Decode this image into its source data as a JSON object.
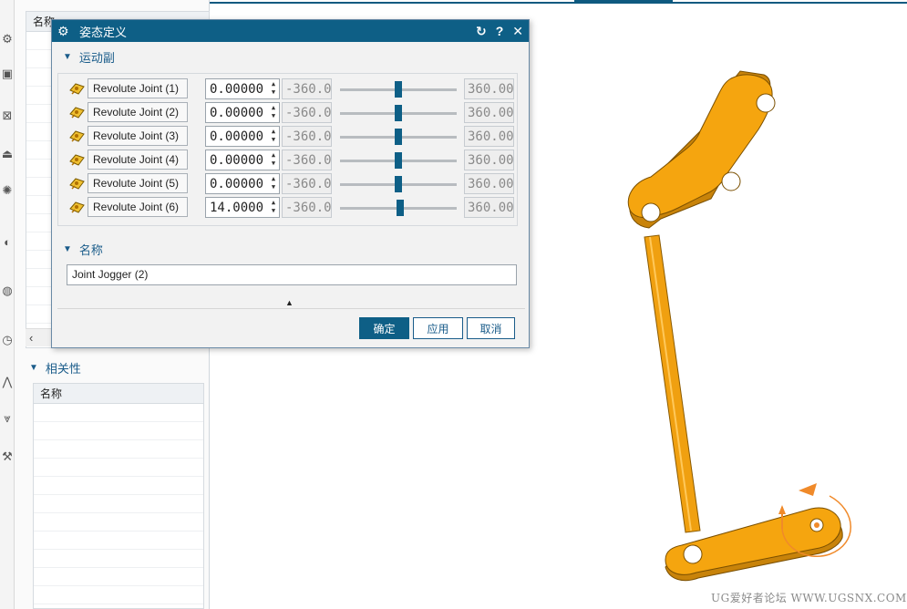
{
  "dialog": {
    "title": "姿态定义",
    "motion_section": "运动副",
    "name_section": "名称",
    "name_value": "Joint Jogger (2)",
    "joints": [
      {
        "label": "Revolute Joint (1)",
        "value": "0.00000",
        "min": "-360.0",
        "max": "360.00",
        "slider_fraction": 0.5
      },
      {
        "label": "Revolute Joint (2)",
        "value": "0.00000",
        "min": "-360.0",
        "max": "360.00",
        "slider_fraction": 0.5
      },
      {
        "label": "Revolute Joint (3)",
        "value": "0.00000",
        "min": "-360.0",
        "max": "360.00",
        "slider_fraction": 0.5
      },
      {
        "label": "Revolute Joint (4)",
        "value": "0.00000",
        "min": "-360.0",
        "max": "360.00",
        "slider_fraction": 0.5
      },
      {
        "label": "Revolute Joint (5)",
        "value": "0.00000",
        "min": "-360.0",
        "max": "360.00",
        "slider_fraction": 0.5
      },
      {
        "label": "Revolute Joint (6)",
        "value": "14.0000",
        "min": "-360.0",
        "max": "360.00",
        "slider_fraction": 0.519
      }
    ],
    "ok_label": "确定",
    "apply_label": "应用",
    "cancel_label": "取消"
  },
  "navigator": {
    "upper_header": "名称",
    "dependency_section": "相关性",
    "dependency_header": "名称"
  },
  "watermark": "UG爱好者论坛 WWW.UGSNX.COM",
  "colors": {
    "title_bar": "#0e5f86",
    "accent": "#1a5c8a",
    "part_fill": "#f5a50f",
    "part_edge": "#7a4f00",
    "rotation_handle": "#f08a2a"
  },
  "icons": {
    "dialog": "gear-icon",
    "reset": "reset-icon",
    "help": "help-icon",
    "close": "close-icon",
    "joint": "revolute-joint-icon"
  }
}
